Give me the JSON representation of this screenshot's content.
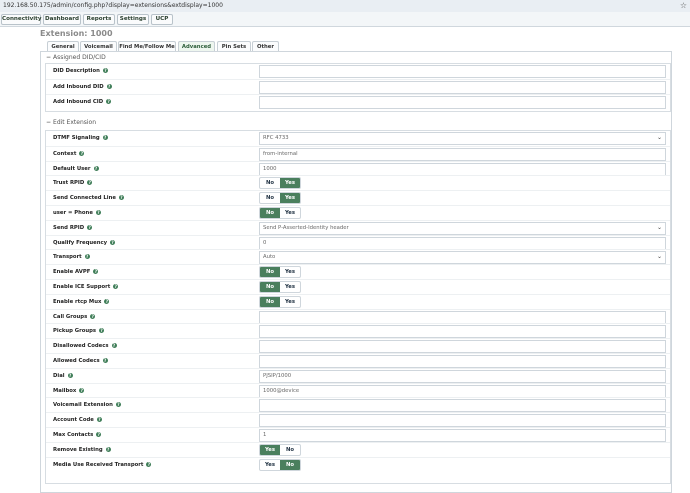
{
  "browser": {
    "url": "192.168.50.175/admin/config.php?display=extensions&extdisplay=1000"
  },
  "topnav": {
    "items": [
      "Connectivity",
      "Dashboard",
      "Reports",
      "Settings",
      "UCP"
    ]
  },
  "page": {
    "title": "Extension: 1000"
  },
  "tabs": [
    "General",
    "Voicemail",
    "Find Me/Follow Me",
    "Advanced",
    "Pin Sets",
    "Other"
  ],
  "sections": {
    "assigned": "Assigned DID/CID",
    "edit": "Edit Extension"
  },
  "assigned_rows": [
    {
      "label": "DID Description",
      "value": ""
    },
    {
      "label": "Add Inbound DID",
      "value": ""
    },
    {
      "label": "Add Inbound CID",
      "value": ""
    }
  ],
  "edit_rows": [
    {
      "label": "DTMF Signaling",
      "type": "select",
      "value": "RFC 4733"
    },
    {
      "label": "Context",
      "type": "input",
      "value": "from-internal"
    },
    {
      "label": "Default User",
      "type": "input",
      "value": "1000"
    },
    {
      "label": "Trust RPID",
      "type": "toggle",
      "left": "No",
      "right": "Yes",
      "selected": "Yes"
    },
    {
      "label": "Send Connected Line",
      "type": "toggle",
      "left": "No",
      "right": "Yes",
      "selected": "Yes"
    },
    {
      "label": "user = Phone",
      "type": "toggle",
      "left": "No",
      "right": "Yes",
      "selected": "No"
    },
    {
      "label": "Send RPID",
      "type": "select",
      "value": "Send P-Asserted-Identity header"
    },
    {
      "label": "Qualify Frequency",
      "type": "input",
      "value": "0"
    },
    {
      "label": "Transport",
      "type": "select",
      "value": "Auto"
    },
    {
      "label": "Enable AVPF",
      "type": "toggle",
      "left": "No",
      "right": "Yes",
      "selected": "No"
    },
    {
      "label": "Enable ICE Support",
      "type": "toggle",
      "left": "No",
      "right": "Yes",
      "selected": "No"
    },
    {
      "label": "Enable rtcp Mux",
      "type": "toggle",
      "left": "No",
      "right": "Yes",
      "selected": "No"
    },
    {
      "label": "Call Groups",
      "type": "input",
      "value": ""
    },
    {
      "label": "Pickup Groups",
      "type": "input",
      "value": ""
    },
    {
      "label": "Disallowed Codecs",
      "type": "input",
      "value": ""
    },
    {
      "label": "Allowed Codecs",
      "type": "input",
      "value": ""
    },
    {
      "label": "Dial",
      "type": "input",
      "value": "PJSIP/1000"
    },
    {
      "label": "Mailbox",
      "type": "input",
      "value": "1000@device"
    },
    {
      "label": "Voicemail Extension",
      "type": "input",
      "value": ""
    },
    {
      "label": "Account Code",
      "type": "input",
      "value": ""
    },
    {
      "label": "Max Contacts",
      "type": "input",
      "value": "1"
    },
    {
      "label": "Remove Existing",
      "type": "toggle",
      "left": "Yes",
      "right": "No",
      "selected": "Yes"
    },
    {
      "label": "Media Use Received Transport",
      "type": "toggle",
      "left": "Yes",
      "right": "No",
      "selected": "No"
    }
  ]
}
